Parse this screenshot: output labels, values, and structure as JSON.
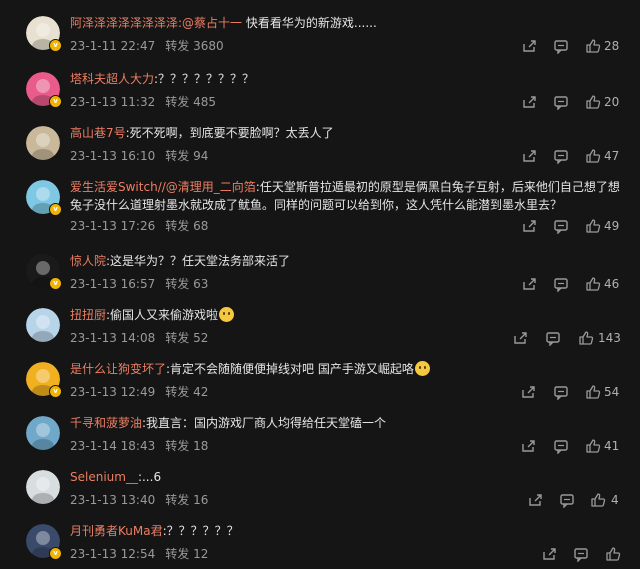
{
  "comments": [
    {
      "username": "阿泽泽泽泽泽泽泽泽",
      "mention": ":@蔡占十一",
      "text": "快看看华为的新游戏......",
      "date": "23-1-11 22:47",
      "forward_label": "转发",
      "forwards": "3680",
      "likes": "28",
      "avatar_color": "#e8e0d0",
      "verified": true
    },
    {
      "username": "塔科夫超人大力",
      "mention": "",
      "text": ":？？？？？？？？",
      "date": "23-1-13 11:32",
      "forward_label": "转发",
      "forwards": "485",
      "likes": "20",
      "avatar_color": "#e85b8a",
      "verified": true
    },
    {
      "username": "高山巷7号",
      "mention": "",
      "text": ":死不死啊，到底要不要脸啊？太丢人了",
      "date": "23-1-13 16:10",
      "forward_label": "转发",
      "forwards": "94",
      "likes": "47",
      "avatar_color": "#c9b89a",
      "verified": false
    },
    {
      "username": "爱生活爱Switch",
      "mention": "//@清理用_二向箔",
      "text": ":任天堂斯普拉遁最初的原型是俩黑白兔子互射，后来他们自己想了想兔子没什么道理射墨水就改成了鱿鱼。同样的问题可以给到你，这人凭什么能潜到墨水里去？",
      "date": "23-1-13 17:26",
      "forward_label": "转发",
      "forwards": "68",
      "likes": "49",
      "avatar_color": "#7ec8e3",
      "verified": true
    },
    {
      "username": "惊人院",
      "mention": "",
      "text": ":这是华为？？任天堂法务部来活了",
      "date": "23-1-13 16:57",
      "forward_label": "转发",
      "forwards": "63",
      "likes": "46",
      "avatar_color": "#1a1a1a",
      "verified": true
    },
    {
      "username": "扭扭厨",
      "mention": "",
      "text": ":偷国人又来偷游戏啦",
      "date": "23-1-13 14:08",
      "forward_label": "转发",
      "forwards": "52",
      "likes": "143",
      "avatar_color": "#b8d4e8",
      "verified": false
    },
    {
      "username": "是什么让狗变坏了",
      "mention": "",
      "text": ":肯定不会随随便便掉线对吧 国产手游又崛起咯",
      "date": "23-1-13 12:49",
      "forward_label": "转发",
      "forwards": "42",
      "likes": "54",
      "avatar_color": "#f0b020",
      "verified": true
    },
    {
      "username": "千寻和菠萝油",
      "mention": "",
      "text": ":我直言：国内游戏厂商人均得给任天堂磕一个",
      "date": "23-1-14 18:43",
      "forward_label": "转发",
      "forwards": "18",
      "likes": "41",
      "avatar_color": "#6fa8c8",
      "verified": false
    },
    {
      "username": "Selenium__",
      "mention": "",
      "text": ":...6",
      "date": "23-1-13 13:40",
      "forward_label": "转发",
      "forwards": "16",
      "likes": "4",
      "avatar_color": "#d8dde0",
      "verified": false
    },
    {
      "username": "月刊勇者KuMa君",
      "mention": "",
      "text": ":？？？？？？",
      "date": "23-1-13 12:54",
      "forward_label": "转发",
      "forwards": "12",
      "likes": "",
      "avatar_color": "#3a4a6a",
      "verified": true
    }
  ],
  "icons": {
    "forward": "share-icon",
    "reply": "comment-icon",
    "like": "thumbs-up-icon"
  }
}
